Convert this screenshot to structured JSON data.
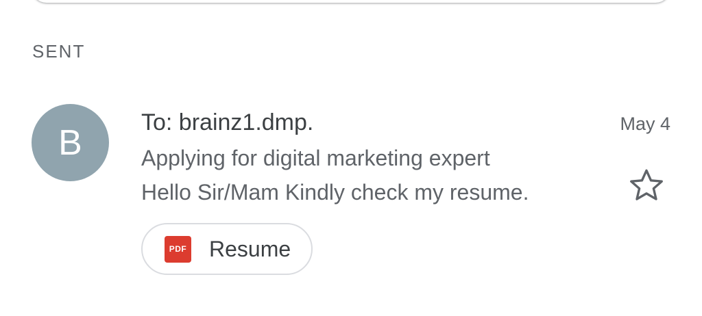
{
  "section": {
    "title": "SENT"
  },
  "email": {
    "avatar_letter": "B",
    "recipient": "To: brainz1.dmp.",
    "date": "May 4",
    "subject": "Applying for digital marketing expert",
    "snippet": "Hello Sir/Mam Kindly check my resume.",
    "starred": false,
    "attachment": {
      "type_label": "PDF",
      "name": "Resume",
      "icon": "pdf-icon"
    }
  },
  "colors": {
    "avatar_bg": "#90a4ae",
    "pdf_red": "#dc3c2f",
    "text_secondary": "#5f6368",
    "text_primary": "#3c4043"
  }
}
